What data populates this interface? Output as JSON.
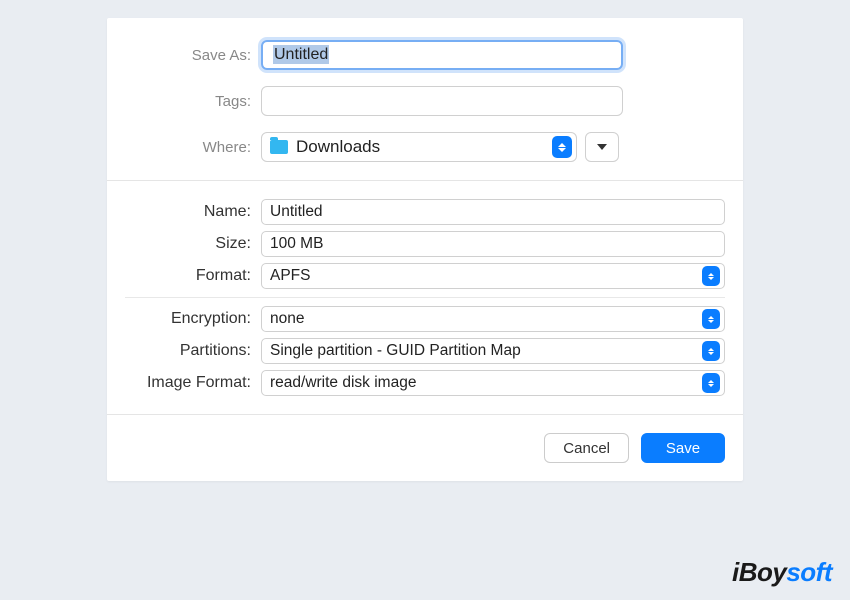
{
  "saveAs": {
    "label": "Save As:",
    "value": "Untitled"
  },
  "tags": {
    "label": "Tags:",
    "value": ""
  },
  "where": {
    "label": "Where:",
    "value": "Downloads"
  },
  "fields": {
    "name": {
      "label": "Name:",
      "value": "Untitled"
    },
    "size": {
      "label": "Size:",
      "value": "100 MB"
    },
    "format": {
      "label": "Format:",
      "value": "APFS"
    },
    "encryption": {
      "label": "Encryption:",
      "value": "none"
    },
    "partitions": {
      "label": "Partitions:",
      "value": "Single partition - GUID Partition Map"
    },
    "imageFormat": {
      "label": "Image Format:",
      "value": "read/write disk image"
    }
  },
  "buttons": {
    "cancel": "Cancel",
    "save": "Save"
  },
  "watermark": {
    "prefix": "iBoy",
    "suffix": "soft"
  }
}
